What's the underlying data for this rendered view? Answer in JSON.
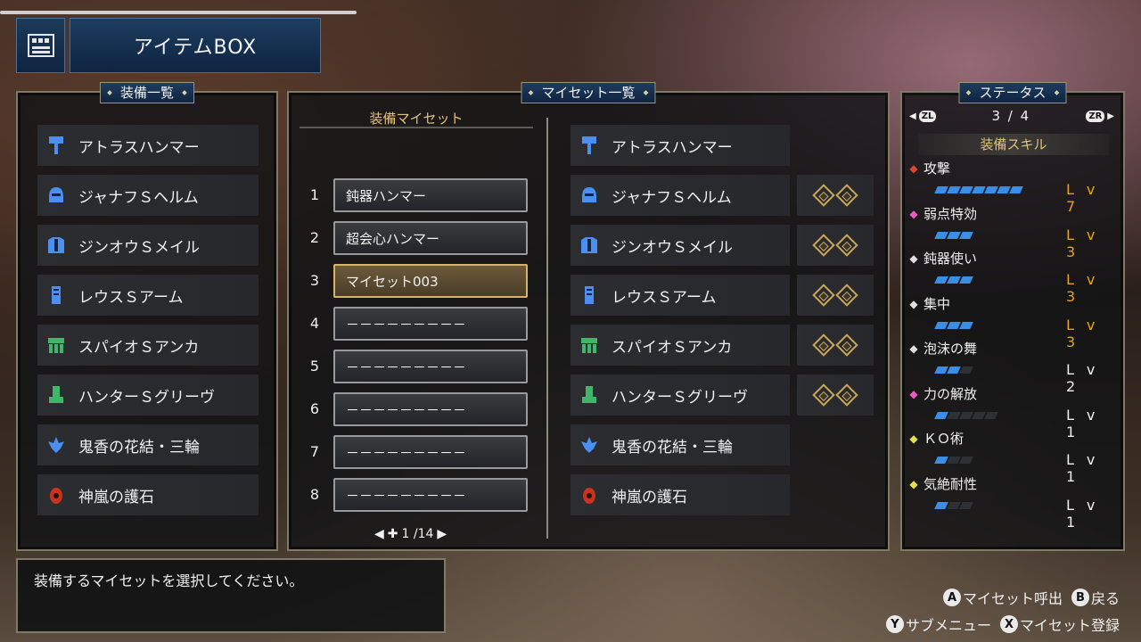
{
  "title": "アイテムBOX",
  "equip_list": {
    "heading": "装備一覧",
    "items": [
      {
        "label": "アトラスハンマー",
        "icon": "hammer-icon"
      },
      {
        "label": "ジャナフＳヘルム",
        "icon": "helm-icon"
      },
      {
        "label": "ジンオウＳメイル",
        "icon": "chest-icon"
      },
      {
        "label": "レウスＳアーム",
        "icon": "arm-icon"
      },
      {
        "label": "スパイオＳアンカ",
        "icon": "waist-icon"
      },
      {
        "label": "ハンターＳグリーヴ",
        "icon": "legs-icon"
      },
      {
        "label": "鬼香の花結・三輪",
        "icon": "petalace-icon"
      },
      {
        "label": "神嵐の護石",
        "icon": "talisman-icon"
      }
    ]
  },
  "myset": {
    "heading": "マイセット一覧",
    "subheading": "装備マイセット",
    "slots": [
      {
        "num": "1",
        "label": "鈍器ハンマー"
      },
      {
        "num": "2",
        "label": "超会心ハンマー"
      },
      {
        "num": "3",
        "label": "マイセット003"
      },
      {
        "num": "4",
        "label": "－－－－－－－－－"
      },
      {
        "num": "5",
        "label": "－－－－－－－－－"
      },
      {
        "num": "6",
        "label": "－－－－－－－－－"
      },
      {
        "num": "7",
        "label": "－－－－－－－－－"
      },
      {
        "num": "8",
        "label": "－－－－－－－－－"
      }
    ],
    "selected_index": 2,
    "page": "1 /14",
    "preview": [
      {
        "label": "アトラスハンマー",
        "icon": "hammer-icon",
        "deco": 0
      },
      {
        "label": "ジャナフＳヘルム",
        "icon": "helm-icon",
        "deco": 2
      },
      {
        "label": "ジンオウＳメイル",
        "icon": "chest-icon",
        "deco": 2
      },
      {
        "label": "レウスＳアーム",
        "icon": "arm-icon",
        "deco": 2
      },
      {
        "label": "スパイオＳアンカ",
        "icon": "waist-icon",
        "deco": 2
      },
      {
        "label": "ハンターＳグリーヴ",
        "icon": "legs-icon",
        "deco": 2
      },
      {
        "label": "鬼香の花結・三輪",
        "icon": "petalace-icon",
        "deco": 0
      },
      {
        "label": "神嵐の護石",
        "icon": "talisman-icon",
        "deco": 0
      }
    ]
  },
  "status": {
    "heading": "ステータス",
    "zl": "ZL",
    "zr": "ZR",
    "page": "3 / 4",
    "skills_heading": "装備スキル",
    "skills": [
      {
        "name": "攻撃",
        "level": 7,
        "max": 7,
        "lv": "Lv 7",
        "highlight": true,
        "color": "#e0442c"
      },
      {
        "name": "弱点特効",
        "level": 3,
        "max": 3,
        "lv": "Lv 3",
        "highlight": true,
        "color": "#e85bbf"
      },
      {
        "name": "鈍器使い",
        "level": 3,
        "max": 3,
        "lv": "Lv 3",
        "highlight": true,
        "color": "#e0e0e0"
      },
      {
        "name": "集中",
        "level": 3,
        "max": 3,
        "lv": "Lv 3",
        "highlight": true,
        "color": "#e0e0e0"
      },
      {
        "name": "泡沫の舞",
        "level": 2,
        "max": 3,
        "lv": "Lv 2",
        "highlight": false,
        "color": "#e0e0e0"
      },
      {
        "name": "力の解放",
        "level": 1,
        "max": 5,
        "lv": "Lv 1",
        "highlight": false,
        "color": "#e85bbf"
      },
      {
        "name": "ＫＯ術",
        "level": 1,
        "max": 3,
        "lv": "Lv 1",
        "highlight": false,
        "color": "#e6e04a"
      },
      {
        "name": "気絶耐性",
        "level": 1,
        "max": 3,
        "lv": "Lv 1",
        "highlight": false,
        "color": "#e6e04a"
      }
    ]
  },
  "message": "装備するマイセットを選択してください。",
  "controls": {
    "a_key": "A",
    "a_label": "マイセット呼出",
    "b_key": "B",
    "b_label": "戻る",
    "y_key": "Y",
    "y_label": "サブメニュー",
    "x_key": "X",
    "x_label": "マイセット登録"
  },
  "colors": {
    "accent": "#d6b36a",
    "skill_bar": "#3a8ee6",
    "lv_highlight": "#e6a21e"
  }
}
